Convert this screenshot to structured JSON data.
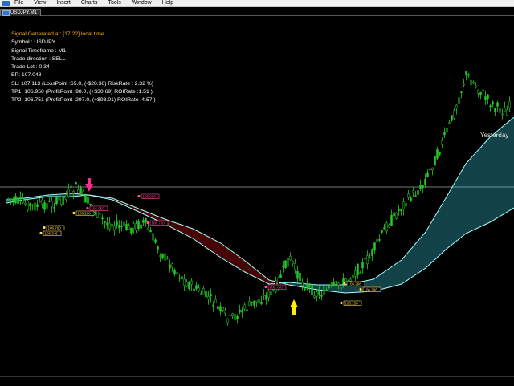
{
  "menubar": {
    "items": [
      "File",
      "View",
      "Insert",
      "Charts",
      "Tools",
      "Window",
      "Help"
    ]
  },
  "tab": {
    "label": "USDJPY,M1"
  },
  "signal": {
    "line1": "Signal Generated at: [17:22] local time",
    "line2": "Symbol : USDJPY",
    "line3": "Signal Timeframe : M1",
    "line4": "Trade direction : SELL",
    "line5": "Trade Lot : 0.34",
    "line6": "EP: 107.048",
    "line7": "SL: 107.113 (LossPoint :65.0, (-$20.36)  RiskRate : 2.32 %)",
    "line8": "TP1: 106.950 (ProfitPoint :98.0, (+$30.69)  ROIRate :1.51 )",
    "line9": "TP2: 106.751 (ProfitPoint :297.0, (+$93.01)  ROIRate :4.57 )"
  },
  "chart": {
    "yesterday_label": "Yesterday",
    "colors": {
      "candle": "#22cc22",
      "cloud_up": "#40e0f0",
      "cloud_down": "#ee1111",
      "arrow_sell": "#ff2a8a",
      "arrow_buy": "#ffee00",
      "hline": "#777777"
    },
    "price_tags": [
      {
        "text": "106.760",
        "color": "#ffd84a"
      },
      {
        "text": "106.345",
        "color": "#ffd84a"
      },
      {
        "text": "106.280",
        "color": "#ffd84a"
      },
      {
        "text": "106.298",
        "color": "#ffd84a"
      },
      {
        "text": "106.296",
        "color": "#ffd84a"
      },
      {
        "text": "106.250",
        "color": "#ffd84a"
      },
      {
        "text": "106.990",
        "color": "#ff4f9a"
      },
      {
        "text": "106.950",
        "color": "#ff4f9a"
      },
      {
        "text": "106.760",
        "color": "#ff4f9a"
      },
      {
        "text": "106.760",
        "color": "#ff4f9a"
      }
    ]
  }
}
